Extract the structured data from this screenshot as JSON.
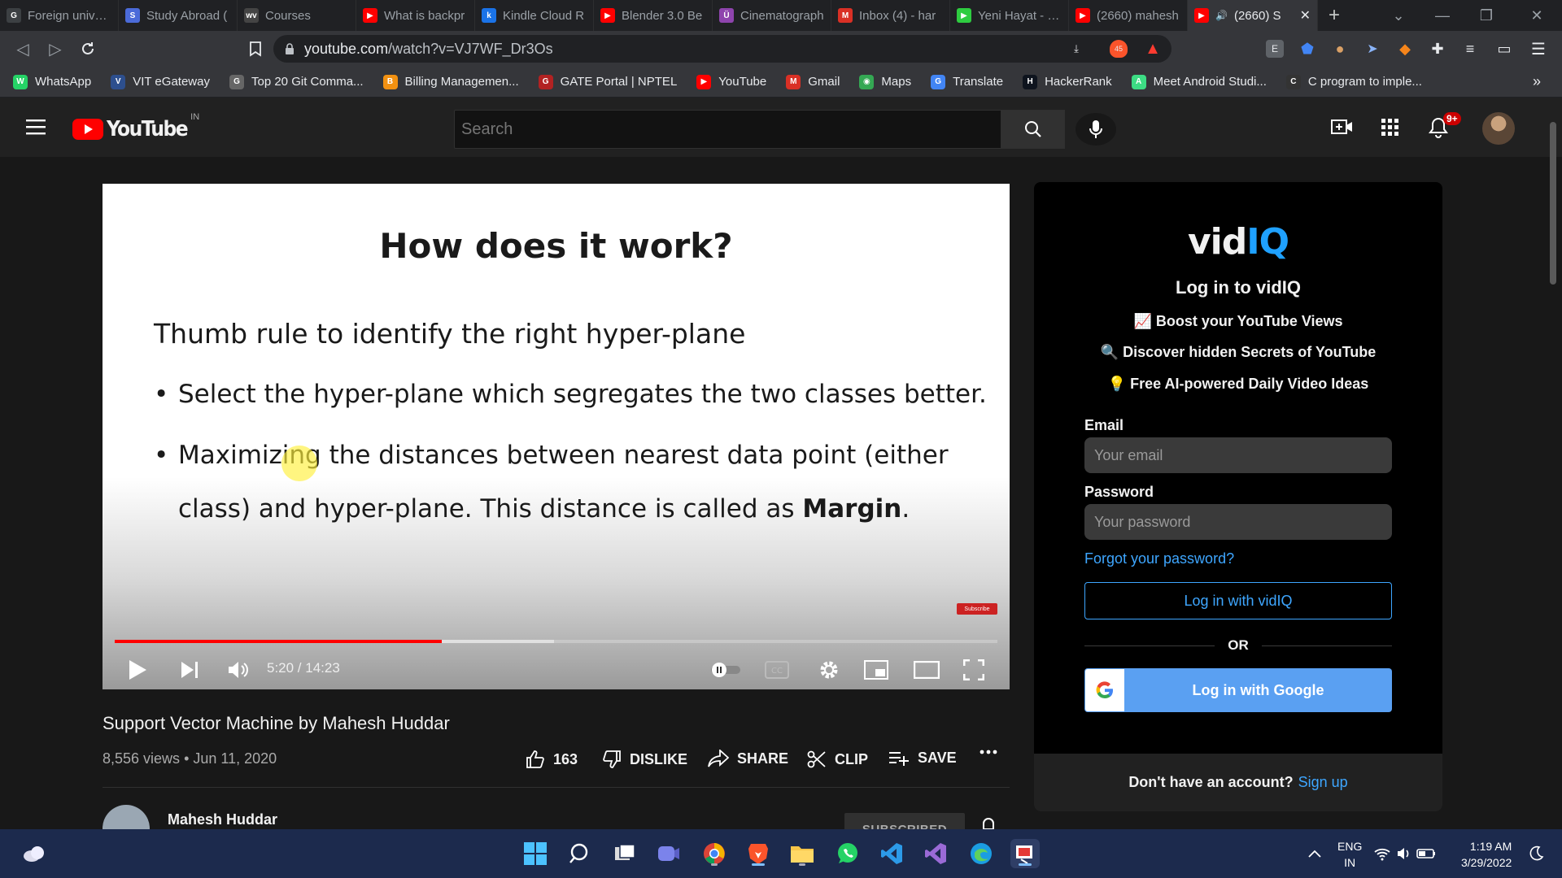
{
  "browser": {
    "tabs": [
      {
        "label": "Foreign univers",
        "favicon": "G",
        "color": "#3c4043",
        "active": false
      },
      {
        "label": "Study Abroad (",
        "favicon": "S",
        "color": "#4b6bd9",
        "active": false
      },
      {
        "label": "Courses",
        "favicon": "wv",
        "color": "#444",
        "active": false
      },
      {
        "label": "What is backpr",
        "favicon": "▶",
        "color": "#ff0000",
        "active": false
      },
      {
        "label": "Kindle Cloud R",
        "favicon": "k",
        "color": "#1a73e8",
        "active": false
      },
      {
        "label": "Blender 3.0 Be",
        "favicon": "▶",
        "color": "#ff0000",
        "active": false
      },
      {
        "label": "Cinematograph",
        "favicon": "Ü",
        "color": "#8e44ad",
        "active": false
      },
      {
        "label": "Inbox (4) - har",
        "favicon": "M",
        "color": "#d93025",
        "active": false
      },
      {
        "label": "Yeni Hayat - Ep",
        "favicon": "▶",
        "color": "#2ecc40",
        "active": false
      },
      {
        "label": "(2660) mahesh",
        "favicon": "▶",
        "color": "#ff0000",
        "active": false
      },
      {
        "label": "(2660) S",
        "favicon": "▶",
        "color": "#ff0000",
        "active": true
      }
    ],
    "url_host": "youtube.com",
    "url_path": "/watch?v=VJ7WF_Dr3Os",
    "bookmarks": [
      {
        "label": "WhatsApp",
        "favicon": "W",
        "color": "#25d366"
      },
      {
        "label": "VIT eGateway",
        "favicon": "V",
        "color": "#2d4f8e"
      },
      {
        "label": "Top 20 Git Comma...",
        "favicon": "G",
        "color": "#666"
      },
      {
        "label": "Billing Managemen...",
        "favicon": "B",
        "color": "#f29111"
      },
      {
        "label": "GATE Portal | NPTEL",
        "favicon": "G",
        "color": "#b22222"
      },
      {
        "label": "YouTube",
        "favicon": "▶",
        "color": "#ff0000"
      },
      {
        "label": "Gmail",
        "favicon": "M",
        "color": "#d93025"
      },
      {
        "label": "Maps",
        "favicon": "◉",
        "color": "#34a853"
      },
      {
        "label": "Translate",
        "favicon": "G",
        "color": "#4285f4"
      },
      {
        "label": "HackerRank",
        "favicon": "H",
        "color": "#0e141e"
      },
      {
        "label": "Meet Android Studi...",
        "favicon": "A",
        "color": "#3ddc84"
      },
      {
        "label": "C program to imple...",
        "favicon": "C",
        "color": "#333"
      }
    ],
    "bookmarks_more": "»",
    "brave_badge": "45"
  },
  "youtube": {
    "logo_text": "YouTube",
    "region": "IN",
    "search_placeholder": "Search",
    "notifications_badge": "9+",
    "video": {
      "slide_title": "How does it work?",
      "slide_lead": "Thumb rule to identify the right hyper-plane",
      "bullet1": "Select the hyper-plane which segregates the two classes better.",
      "bullet2_line1": "Maximizing the distances between nearest data point (either",
      "bullet2_line2_pre": "class) and hyper-plane. This distance is called as ",
      "bullet2_bold": "Margin",
      "bullet2_end": ".",
      "subscribe_badge": "Subscribe",
      "timecode": "5:20 / 14:23",
      "played_fraction": 0.3708,
      "buffered_fraction": 0.4977
    },
    "title": "Support Vector Machine by Mahesh Huddar",
    "views": "8,556 views",
    "date": "Jun 11, 2020",
    "actions": {
      "likes": "163",
      "dislike": "DISLIKE",
      "share": "SHARE",
      "clip": "CLIP",
      "save": "SAVE"
    },
    "channel_name": "Mahesh Huddar",
    "subscribed": "SUBSCRIBED"
  },
  "vidiq": {
    "logo_vid": "vid",
    "logo_iq": "IQ",
    "heading": "Log in to vidIQ",
    "perks": [
      "📈 Boost your YouTube Views",
      "🔍 Discover hidden Secrets of YouTube",
      "💡 Free AI-powered Daily Video Ideas"
    ],
    "email_label": "Email",
    "email_placeholder": "Your email",
    "password_label": "Password",
    "password_placeholder": "Your password",
    "forgot": "Forgot your password?",
    "login_vidiq": "Log in with vidIQ",
    "or": "OR",
    "login_google": "Log in with Google",
    "footer_text": "Don't have an account?",
    "signup": "Sign up"
  },
  "taskbar": {
    "lang_line1": "ENG",
    "lang_line2": "IN",
    "time": "1:19 AM",
    "date": "3/29/2022"
  }
}
